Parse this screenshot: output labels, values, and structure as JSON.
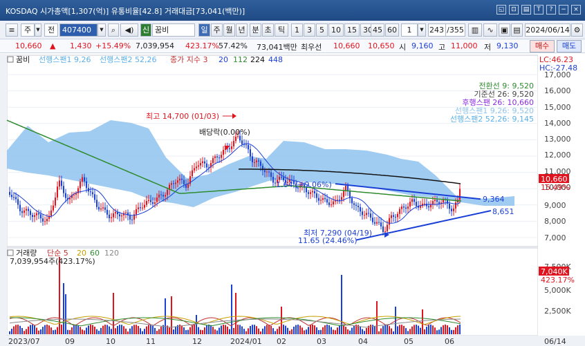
{
  "titlebar": {
    "title": "KOSDAQ 시가총액[1,307(억)] 유통비율[42.8] 거래대금[73,041(백만)]",
    "buttons": [
      "◱",
      "⊡",
      "▤",
      "T",
      "?",
      "−",
      "×"
    ]
  },
  "toolbar": {
    "week_label": "주",
    "all_label": "전",
    "code": "407400",
    "tag": "신",
    "stock_name": "꿈비",
    "periods": [
      "일",
      "주",
      "월",
      "년",
      "분",
      "초",
      "틱"
    ],
    "active_period": "일",
    "intervals": [
      "1",
      "3",
      "5",
      "10",
      "15",
      "30",
      "45",
      "60"
    ],
    "interval_value": "1",
    "count_current": "243",
    "count_total": "/355",
    "date": "2024/06/14"
  },
  "quote": {
    "price": "10,660",
    "arrow": "▲",
    "change": "1,430",
    "change_pct": "+15.49%",
    "volume": "7,039,954",
    "volume_pct": "423.17%",
    "turnover": "57.42%",
    "amount": "73,041백만",
    "cheoson_label": "최우선",
    "ask": "10,660",
    "bid": "10,650",
    "open_label": "시",
    "open": "9,160",
    "high_label": "고",
    "high": "11,000",
    "low_label": "저",
    "low": "9,130",
    "buy_label": "매수",
    "sell_label": "매도"
  },
  "price_panel": {
    "legend_name": "꿈비",
    "legend_items": [
      "선행스팬1 9,26",
      "선행스팬2 52,26",
      "종가 지수 3",
      "20",
      "112",
      "224",
      "448"
    ],
    "lc": "LC:46.23",
    "hc": "HC:-27.48",
    "ichimoku_labels": [
      "전환선 9: 9,520",
      "기준선 26: 9,520",
      "후행스팬 26: 10,660",
      "선행스팬1 9,26: 9,520",
      "선행스팬2 52,26: 9,145"
    ],
    "annotations": {
      "high": "최고 14,700 (01/03)",
      "dividend": "배당락(0.00%)",
      "low": "최저 7,290 (04/19)",
      "low_pct": "11.65 (24.46%)",
      "mid_pct": "1.64 (+9.06%)",
      "trend_upper": "9,364",
      "trend_lower": "8,651"
    },
    "current_price": "10,660",
    "current_pct": "15.49%",
    "y_ticks": [
      "17,000",
      "16,000",
      "15,000",
      "14,000",
      "13,000",
      "12,000",
      "11,000",
      "10,000",
      "9,000",
      "8,000",
      "7,000"
    ]
  },
  "volume_panel": {
    "legend_name": "거래량",
    "legend_items": [
      "단순 5",
      "20",
      "60",
      "120"
    ],
    "volume_label": "7,039,954주(423.17%)",
    "current_volume": "7,040K",
    "current_pct": "423.17%",
    "y_ticks": [
      "7,500K",
      "5,000K",
      "2,500K"
    ]
  },
  "x_axis": {
    "labels": [
      "2023/07",
      "09",
      "10",
      "11",
      "12",
      "2024/01",
      "02",
      "03",
      "04",
      "05",
      "06",
      "06/14"
    ]
  },
  "colors": {
    "up": "#e0141e",
    "down": "#1a3fd6",
    "cloud": "#8fc3ee",
    "ma20": "#1a3fd6",
    "ma112": "#2e8b2e",
    "ma224": "#111111"
  }
}
